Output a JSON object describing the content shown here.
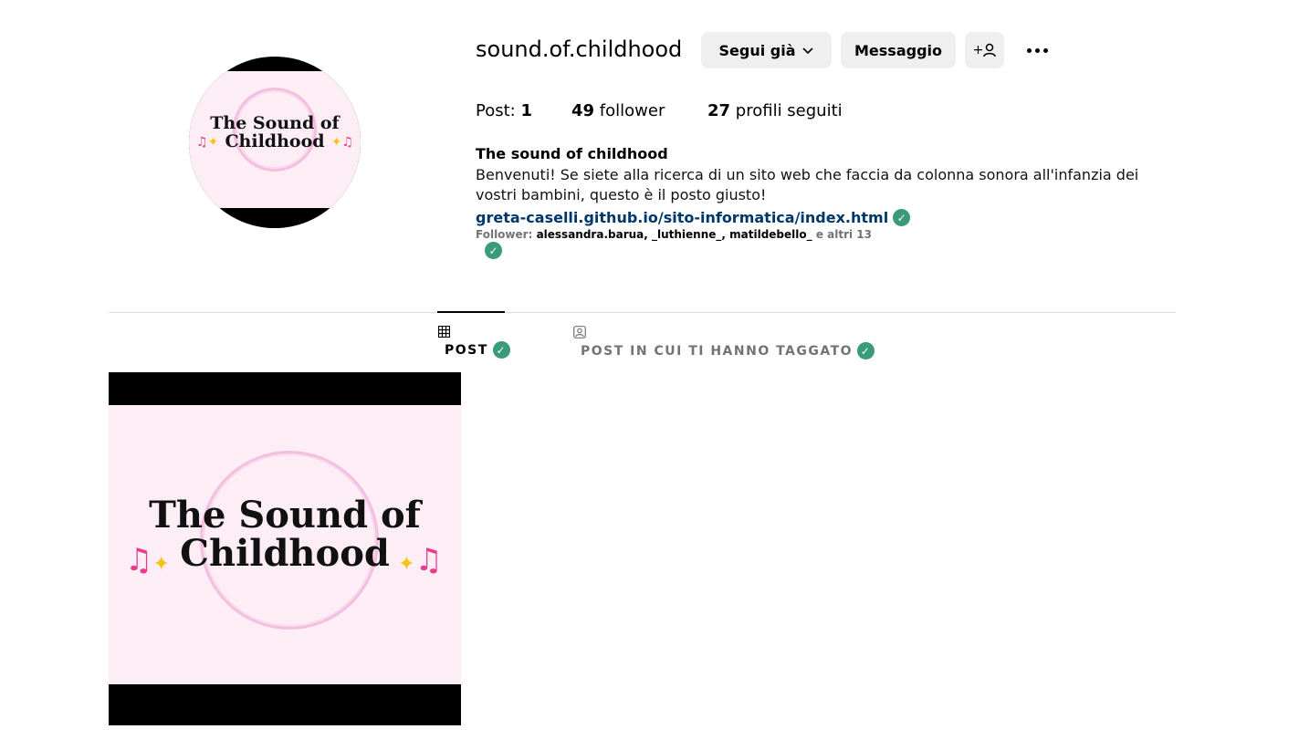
{
  "profile": {
    "username": "sound.of.childhood",
    "avatar_logo_line1": "The Sound of",
    "avatar_logo_line2": "Childhood"
  },
  "actions": {
    "follow_label": "Segui già",
    "message_label": "Messaggio",
    "add_user_label": "+",
    "add_user_icon": "person-add-icon",
    "more_icon": "more-options-icon"
  },
  "stats": {
    "posts_label": "Post:",
    "posts_value": "1",
    "followers_value": "49",
    "followers_label": "follower",
    "following_value": "27",
    "following_label": "profili seguiti"
  },
  "bio": {
    "name": "The sound of childhood",
    "text": "Benvenuti! Se siete alla ricerca di un sito web che faccia da colonna sonora all'infanzia dei vostri bambini, questo è il posto giusto!",
    "link": "greta-caselli.github.io/sito-informatica/index.html",
    "followed_by_label": "Follower:",
    "followed_by_names": "alessandra.barua, _luthienne_, matildebello_",
    "followed_by_more": "e altri 13"
  },
  "tabs": [
    {
      "label": "POST",
      "icon": "grid-icon",
      "active": true
    },
    {
      "label": "POST IN CUI TI HANNO TAGGATO",
      "icon": "tagged-icon",
      "active": false
    }
  ],
  "posts": [
    {
      "logo_line1": "The Sound of",
      "logo_line2": "Childhood"
    }
  ],
  "colors": {
    "verified_check": "#3a9a7a",
    "link": "#00376b",
    "button_bg": "#efefef",
    "logo_bg": "#fdeef6",
    "ring": "#f3bfe0"
  }
}
